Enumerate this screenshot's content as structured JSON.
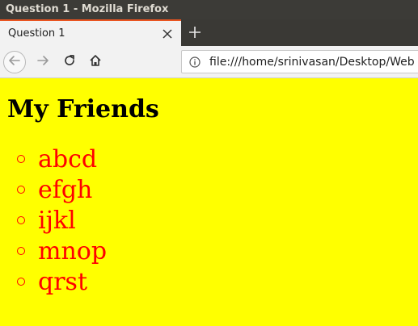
{
  "window": {
    "title": "Question 1 - Mozilla Firefox"
  },
  "tabs": [
    {
      "label": "Question 1"
    }
  ],
  "navbar": {
    "url": "file:///home/srinivasan/Desktop/Web"
  },
  "icons": {
    "tab_close": "close-icon",
    "new_tab": "plus-icon",
    "back": "back-arrow-icon",
    "forward": "forward-arrow-icon",
    "reload": "reload-icon",
    "home": "home-icon",
    "site_info": "info-icon"
  },
  "page": {
    "heading": "My Friends",
    "friends": [
      "abcd",
      "efgh",
      "ijkl",
      "mnop",
      "qrst"
    ]
  },
  "colors": {
    "page_background": "#ffff00",
    "heading_color": "#000000",
    "list_color": "#ff0000",
    "tab_accent": "#e95420"
  }
}
